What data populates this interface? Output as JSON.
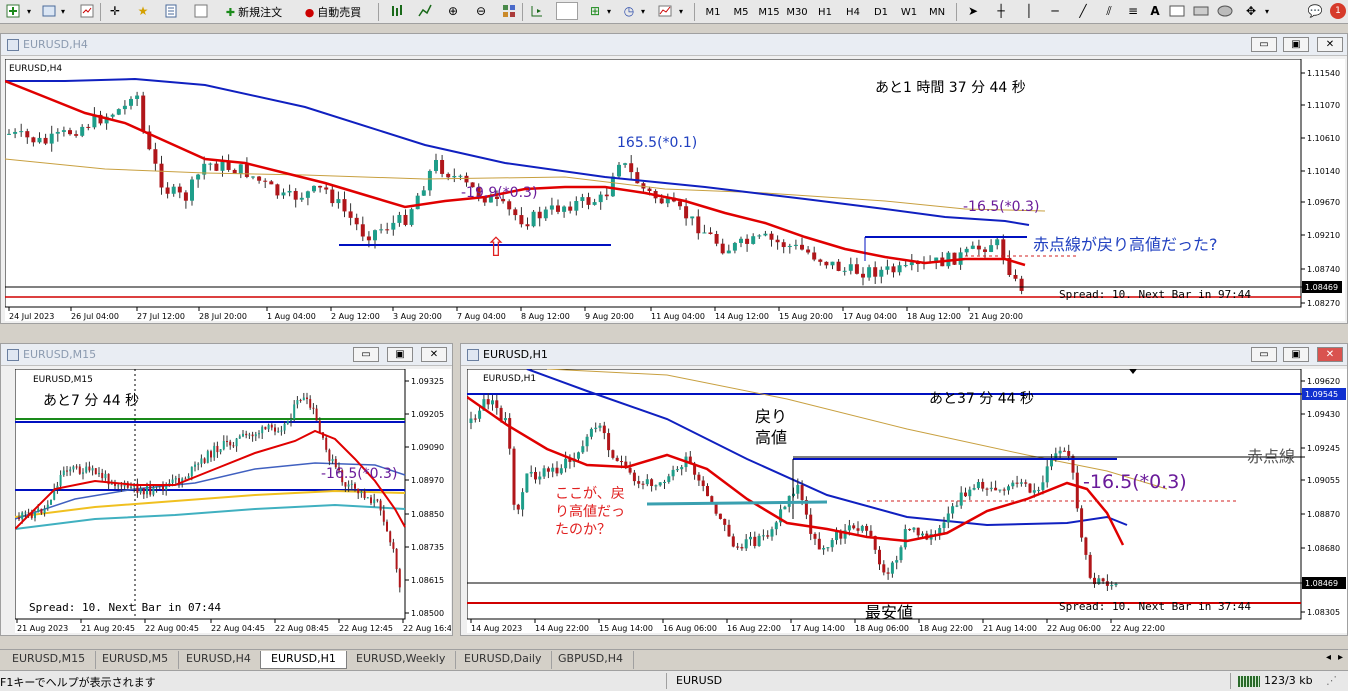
{
  "toolbar": {
    "new_order": "新規注文",
    "auto_trade": "自動売買",
    "timeframes": [
      "M1",
      "M5",
      "M15",
      "M30",
      "H1",
      "H4",
      "D1",
      "W1",
      "MN"
    ]
  },
  "windows": {
    "h4": {
      "title": "EURUSD,H4",
      "chart_label": "EURUSD,H4",
      "countdown": "あと1 時間 37 分 44 秒",
      "spread": "Spread: 10. Next Bar in 97:44",
      "annot_peak": "165.5(*0.1)",
      "annot_mid": "-19.9(*0.3)",
      "annot_right": "-16.5(*0.3)",
      "comment": "赤点線が戻り高値だった?",
      "arrow": "⇧",
      "price_ticks": [
        "1.11540",
        "1.11070",
        "1.10610",
        "1.10140",
        "1.09670",
        "1.09210",
        "1.08740",
        "1.08469",
        "1.08270"
      ],
      "time_ticks": [
        "24 Jul 2023",
        "26 Jul 04:00",
        "27 Jul 12:00",
        "28 Jul 20:00",
        "1 Aug 04:00",
        "2 Aug 12:00",
        "3 Aug 20:00",
        "7 Aug 04:00",
        "8 Aug 12:00",
        "9 Aug 20:00",
        "11 Aug 04:00",
        "14 Aug 12:00",
        "15 Aug 20:00",
        "17 Aug 04:00",
        "18 Aug 12:00",
        "21 Aug 20:00"
      ]
    },
    "m15": {
      "title": "EURUSD,M15",
      "chart_label": "EURUSD,M15",
      "countdown": "あと7 分 44 秒",
      "spread": "Spread: 10. Next Bar in 07:44",
      "annot": "-16.5(*0.3)",
      "price_ticks": [
        "1.09325",
        "1.09205",
        "1.09090",
        "1.08970",
        "1.08850",
        "1.08735",
        "1.08615",
        "1.08500"
      ],
      "time_ticks": [
        "21 Aug 2023",
        "21 Aug 20:45",
        "22 Aug 00:45",
        "22 Aug 04:45",
        "22 Aug 08:45",
        "22 Aug 12:45",
        "22 Aug 16:4"
      ]
    },
    "h1": {
      "title": "EURUSD,H1",
      "chart_label": "EURUSD,H1",
      "countdown": "あと37 分 44 秒",
      "spread": "Spread: 10. Next Bar in 37:44",
      "annot": "-16.5(*0.3)",
      "label_modori1": "戻り",
      "label_modori2": "高値",
      "label_saiyasu": "最安値",
      "label_question1": "ここが、戻",
      "label_question2": "り高値だっ",
      "label_question3": "たのか？",
      "label_right": "赤点線",
      "price_ticks": [
        "1.09620",
        "1.09545",
        "1.09430",
        "1.09245",
        "1.09055",
        "1.08870",
        "1.08680",
        "1.08469",
        "1.08305"
      ],
      "time_ticks": [
        "14 Aug 2023",
        "14 Aug 22:00",
        "15 Aug 14:00",
        "16 Aug 06:00",
        "16 Aug 22:00",
        "17 Aug 14:00",
        "18 Aug 06:00",
        "18 Aug 22:00",
        "21 Aug 14:00",
        "22 Aug 06:00",
        "22 Aug 22:00"
      ]
    }
  },
  "tabs": [
    "EURUSD,M15",
    "EURUSD,M5",
    "EURUSD,H4",
    "EURUSD,H1",
    "EURUSD,Weekly",
    "EURUSD,Daily",
    "GBPUSD,H4"
  ],
  "active_tab": "EURUSD,H1",
  "status": {
    "help": "F1キーでヘルプが表示されます",
    "symbol": "EURUSD",
    "traffic": "123/3 kb"
  },
  "colors": {
    "bull": "#1e9e8a",
    "bear": "#b0161a",
    "ma_red": "#e00000",
    "ma_blue": "#1020c0",
    "ma_gold": "#c8a040",
    "line_blue": "#0010c0",
    "teal": "#3aa0b0",
    "purple": "#6a1b9a"
  }
}
